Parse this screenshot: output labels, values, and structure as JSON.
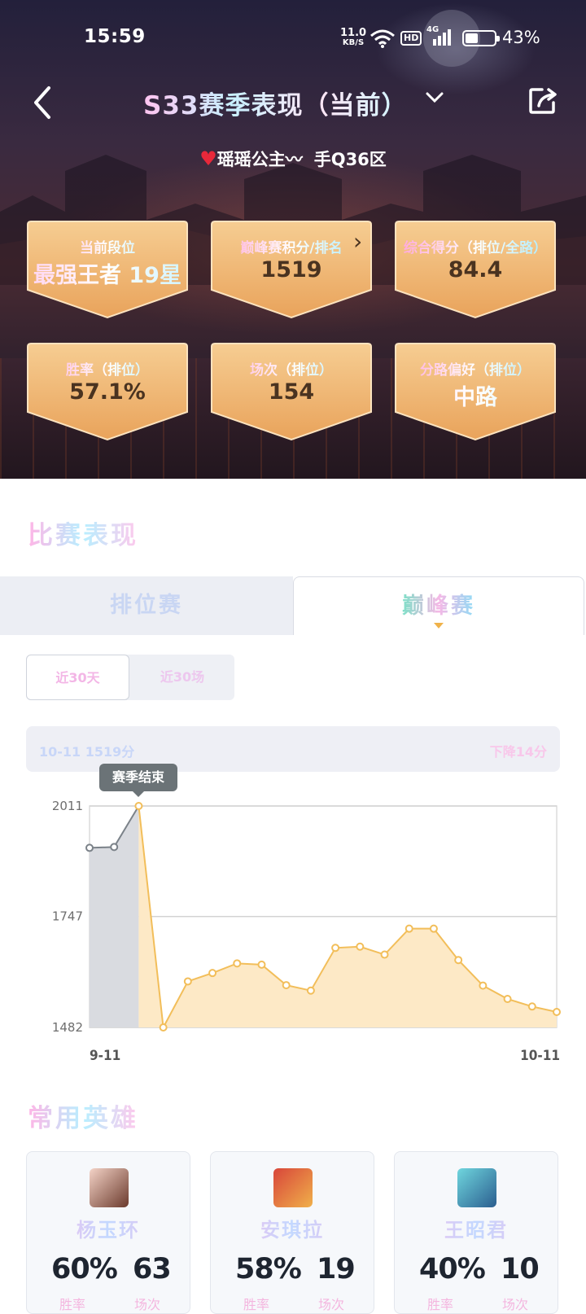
{
  "status_bar": {
    "time": "15:59",
    "net_speed_value": "11.0",
    "net_speed_unit": "KB/S",
    "hd": "HD",
    "signal_label": "4G",
    "battery": "43%",
    "battery_level": 0.43
  },
  "header": {
    "title": "S33赛季表现（当前）",
    "player_name": "瑶瑶公主",
    "server": "手Q36区"
  },
  "stats": [
    {
      "label": "当前段位",
      "value": "最强王者 19星"
    },
    {
      "label": "巅峰赛积分/排名",
      "value": "1519"
    },
    {
      "label": "综合得分（排位/全路）",
      "value": "84.4"
    },
    {
      "label": "胜率（排位）",
      "value": "57.1%"
    },
    {
      "label": "场次（排位）",
      "value": "154"
    },
    {
      "label": "分路偏好（排位）",
      "value": "中路"
    }
  ],
  "match_section": {
    "title": "比赛表现",
    "tabs": [
      "排位赛",
      "巅峰赛"
    ],
    "active_tab": "巅峰赛",
    "segments": [
      "近30天",
      "近30场"
    ],
    "active_segment": "近30天",
    "info_left": "10-11 1519分",
    "info_right": "下降14分",
    "badge": "赛季结束"
  },
  "chart_data": {
    "type": "area",
    "x_labels": [
      "9-11",
      "10-11"
    ],
    "y_ticks": [
      2011,
      1747,
      1482
    ],
    "ylim": [
      1482,
      2011
    ],
    "grid": "horizontal",
    "highlight_region_points": 3,
    "values": [
      1911,
      1913,
      2011,
      1482,
      1592,
      1612,
      1635,
      1632,
      1583,
      1570,
      1672,
      1675,
      1656,
      1718,
      1718,
      1643,
      1582,
      1550,
      1532,
      1519
    ],
    "colors": {
      "line": "#f2be5a",
      "fill": "#fde9c6",
      "previous_fill": "#d9dbe0",
      "previous_line": "#7b8289"
    }
  },
  "heroes_section": {
    "title": "常用英雄",
    "win_rate_label": "胜率",
    "games_label": "场次",
    "heroes": [
      {
        "name": "杨玉环",
        "win_rate": "60%",
        "games": "63"
      },
      {
        "name": "安琪拉",
        "win_rate": "58%",
        "games": "19"
      },
      {
        "name": "王昭君",
        "win_rate": "40%",
        "games": "10"
      }
    ]
  }
}
